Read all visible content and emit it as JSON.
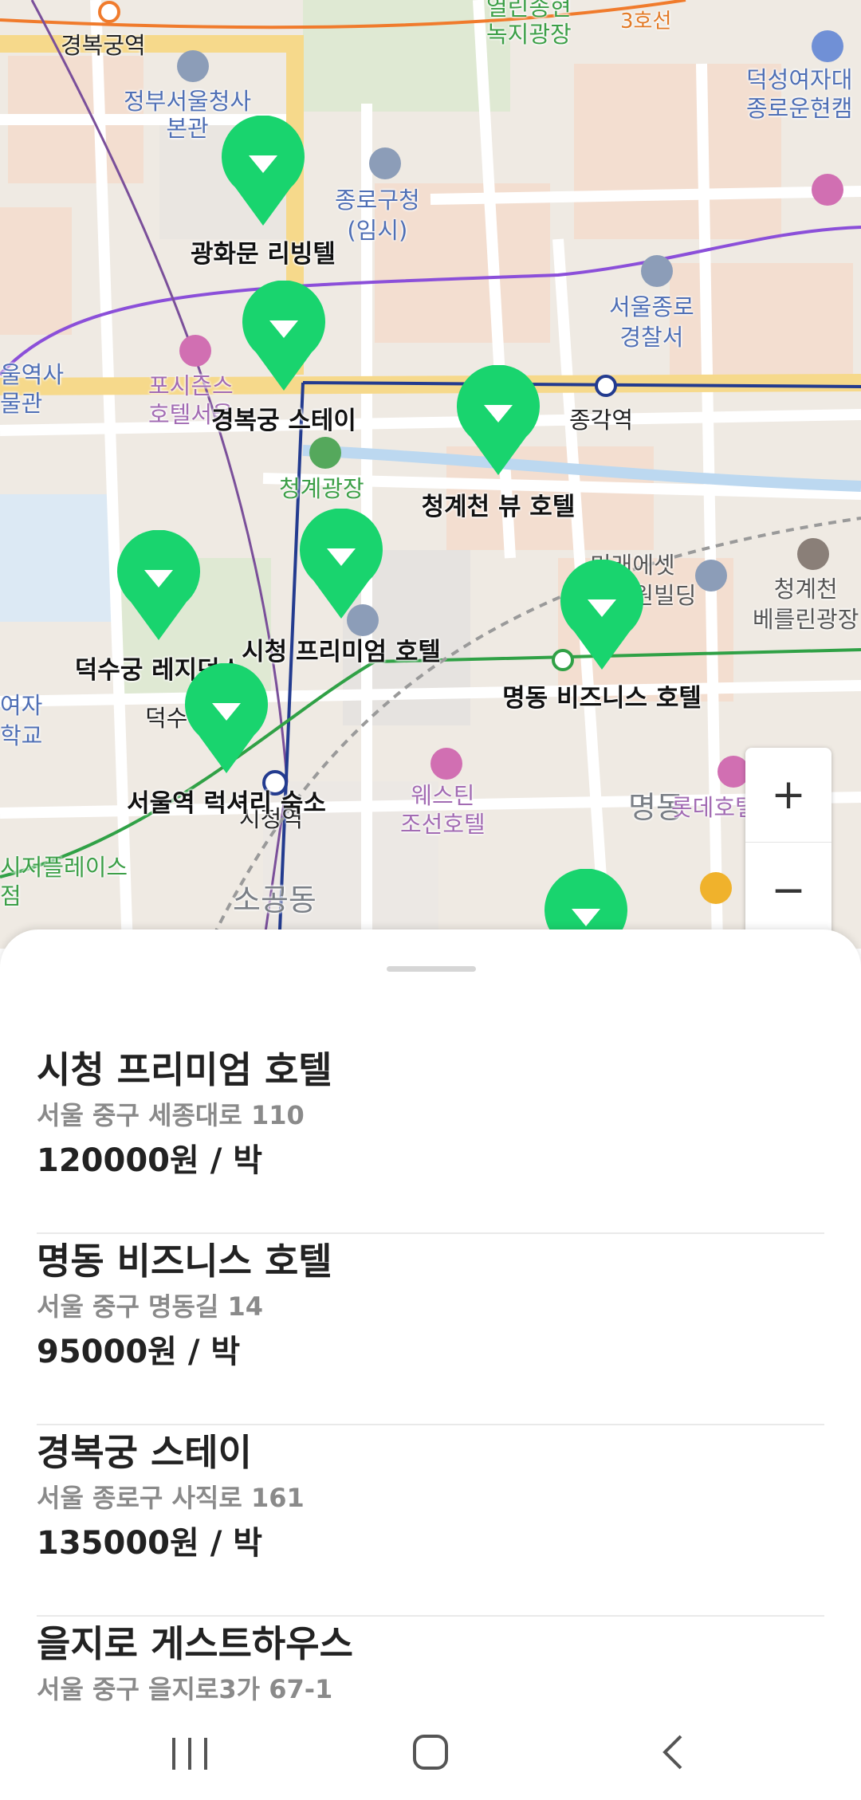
{
  "map": {
    "labels": {
      "gyeongbokgung_station": "경복궁역",
      "seoul_govt_complex": "정부서울청사\n본관",
      "jongno_gu_office": "종로구청\n(임시)",
      "jongno_police": "서울종로\n경찰서",
      "jonggak_station": "종각역",
      "cheonggye_plaza": "청계광장",
      "four_seasons": "포시즌스\n호텔서울",
      "westin": "웨스틴\n조선호텔",
      "deoksung_campus": "덕성여자대\n종로운현캠",
      "cheonggye_berlin": "청계천\n베를린광장",
      "mirae_asset": "미래에셋\n센터원빌딩",
      "open_songhyeon": "열린송현\n녹지광장",
      "line3": "3호선",
      "sogong_dong": "소공동",
      "myeongdong_district": "명동",
      "lotte_hotel": "롯데호텔",
      "city_hall_station": "시청역",
      "seoul_museum": "울역사\n물관",
      "ewha_school": "여자\n학교",
      "place_label": "시저플레이스\n점",
      "deoksu_partial": "덕수"
    },
    "markers": [
      {
        "name": "광화문 리빙텔",
        "color": "#19d46e"
      },
      {
        "name": "경복궁 스테이",
        "color": "#19d46e"
      },
      {
        "name": "청계천 뷰 호텔",
        "color": "#19d46e"
      },
      {
        "name": "시청 프리미엄 호텔",
        "color": "#19d46e"
      },
      {
        "name": "덕수궁 레지던스",
        "color": "#19d46e"
      },
      {
        "name": "명동 비즈니스 호텔",
        "color": "#19d46e"
      },
      {
        "name": "서울역 럭셔리 숙소",
        "color": "#19d46e"
      },
      {
        "name": "",
        "color": "#19d46e"
      }
    ],
    "zoom": {
      "plus": "+",
      "minus": "−"
    }
  },
  "sheet": {
    "items": [
      {
        "name": "시청 프리미엄 호텔",
        "address": "서울 중구 세종대로 110",
        "price": "120000원 / 박"
      },
      {
        "name": "명동 비즈니스 호텔",
        "address": "서울 중구 명동길 14",
        "price": "95000원 / 박"
      },
      {
        "name": "경복궁 스테이",
        "address": "서울 종로구 사직로 161",
        "price": "135000원 / 박"
      },
      {
        "name": "을지로 게스트하우스",
        "address": "서울 중구 을지로3가 67-1",
        "price": ""
      }
    ]
  },
  "colors": {
    "marker": "#19d46e",
    "road_major": "#f6d98b",
    "line1": "#233b8f",
    "line2": "#30a146",
    "line3": "#f07b2c",
    "line5": "#8b4fd9"
  },
  "navbar": {
    "icons": [
      "recent-apps-icon",
      "home-icon",
      "back-icon"
    ]
  }
}
